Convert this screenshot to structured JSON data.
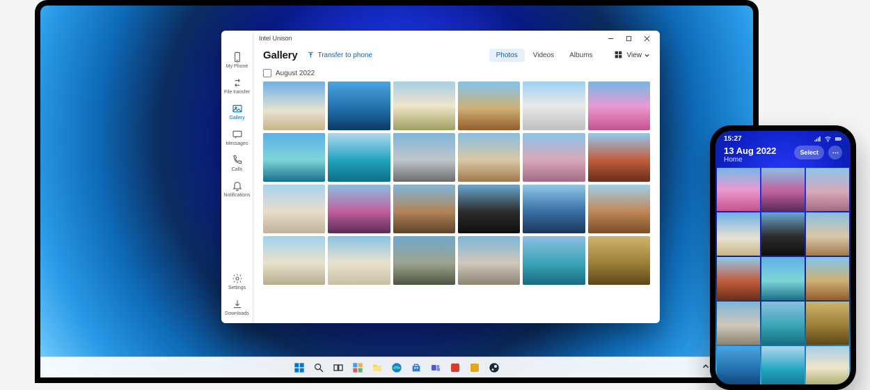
{
  "window": {
    "title": "Intel Unison",
    "controls": {
      "minimize": "min",
      "maximize": "max",
      "close": "close"
    }
  },
  "sidebar": {
    "items": [
      {
        "icon": "phone-icon",
        "label": "My Phone"
      },
      {
        "icon": "transfer-icon",
        "label": "File transfer"
      },
      {
        "icon": "gallery-icon",
        "label": "Gallery",
        "active": true
      },
      {
        "icon": "messages-icon",
        "label": "Messages"
      },
      {
        "icon": "calls-icon",
        "label": "Calls"
      },
      {
        "icon": "notifications-icon",
        "label": "Notifications"
      }
    ],
    "bottom": [
      {
        "icon": "settings-icon",
        "label": "Settings"
      },
      {
        "icon": "downloads-icon",
        "label": "Downloads"
      }
    ]
  },
  "header": {
    "title": "Gallery",
    "transfer_label": "Transfer to phone",
    "view_label": "View"
  },
  "tabs": [
    {
      "label": "Photos",
      "active": true
    },
    {
      "label": "Videos",
      "active": false
    },
    {
      "label": "Albums",
      "active": false
    }
  ],
  "filter": {
    "month_label": "August 2022",
    "checked": false
  },
  "photos": {
    "count": 24
  },
  "taskbar": {
    "items": [
      "start-icon",
      "search-icon",
      "task-view-icon",
      "widgets-icon",
      "explorer-icon",
      "edge-icon",
      "store-icon",
      "teams-icon",
      "app-icon-red",
      "app-icon-yellow",
      "steam-icon"
    ]
  },
  "tray": {
    "items": [
      "chevron-up-icon",
      "cloud-icon",
      "wifi-icon",
      "volume-icon"
    ]
  },
  "phone": {
    "status_time": "15:27",
    "date": "13 Aug 2022",
    "subtitle": "Home",
    "select_label": "Select",
    "photos": {
      "count": 15
    }
  }
}
